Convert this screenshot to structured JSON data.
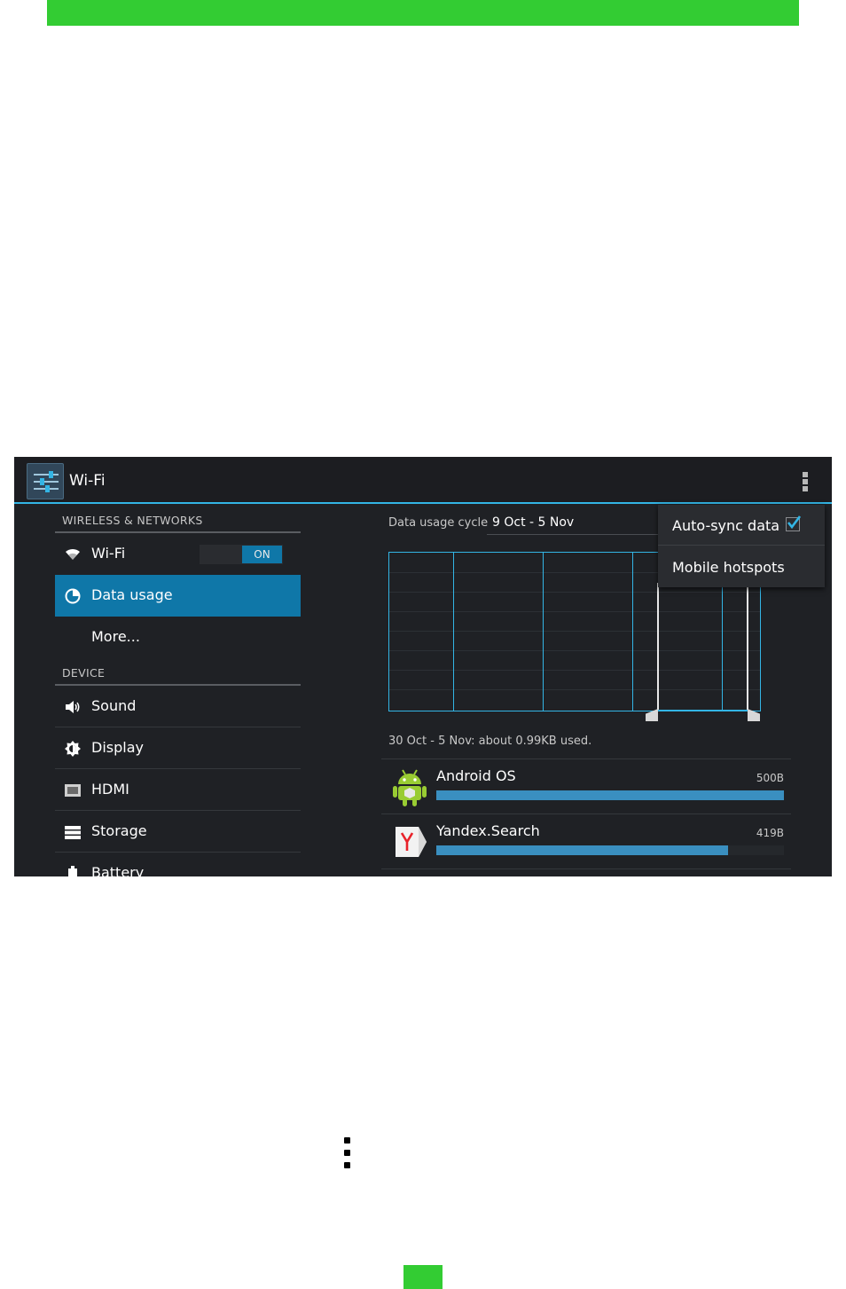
{
  "action_bar": {
    "title": "Wi-Fi"
  },
  "left_pane": {
    "wireless_header": "WIRELESS & NETWORKS",
    "wifi": {
      "label": "Wi-Fi",
      "toggle_state": "ON"
    },
    "data_usage": {
      "label": "Data usage",
      "selected": true
    },
    "more": {
      "label": "More..."
    },
    "device_header": "DEVICE",
    "device_items": [
      {
        "label": "Sound",
        "icon": "speaker-icon"
      },
      {
        "label": "Display",
        "icon": "brightness-icon"
      },
      {
        "label": "HDMI",
        "icon": "hdmi-icon"
      },
      {
        "label": "Storage",
        "icon": "storage-icon"
      },
      {
        "label": "Battery",
        "icon": "battery-icon"
      }
    ]
  },
  "right_pane": {
    "cycle_label": "Data usage cycle",
    "cycle_value": "9 Oct - 5 Nov",
    "usage_summary": "30 Oct - 5 Nov: about 0.99KB used.",
    "apps": [
      {
        "name": "Android OS",
        "size": "500B",
        "usage_fraction": 1.0,
        "icon": "android-icon"
      },
      {
        "name": "Yandex.Search",
        "size": "419B",
        "usage_fraction": 0.84,
        "icon": "yandex-icon"
      }
    ]
  },
  "popup_menu": {
    "items": [
      {
        "label": "Auto-sync data",
        "checked": true
      },
      {
        "label": "Mobile hotspots"
      }
    ]
  },
  "colors": {
    "page_accent": "#33cc33",
    "holo_blue": "#33b5e5",
    "selected_bg": "#0f77a8",
    "screen_bg": "#1f2125"
  }
}
